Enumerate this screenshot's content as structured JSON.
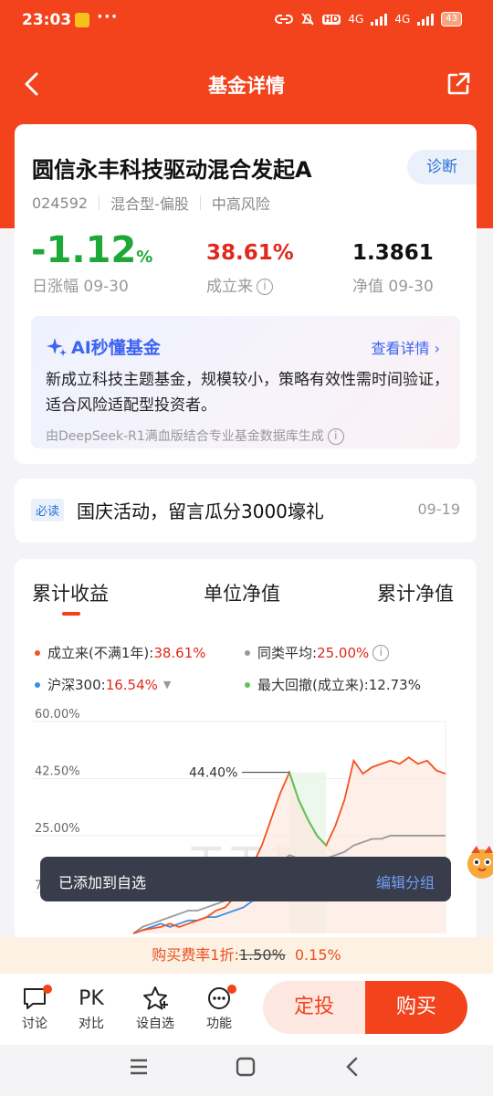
{
  "status_bar": {
    "time": "23:03",
    "more": "···",
    "hd": "HD",
    "net1": "4G",
    "net2": "4G",
    "battery": "43"
  },
  "nav": {
    "title": "基金详情"
  },
  "fund": {
    "name": "圆信永丰科技驱动混合发起A",
    "diagnose_label": "诊断",
    "code": "024592",
    "type": "混合型-偏股",
    "risk": "中高风险",
    "daily_change": "-1.12",
    "daily_change_unit": "%",
    "daily_change_label": "日涨幅 09-30",
    "since_inception": "38.61%",
    "since_inception_label": "成立来",
    "nav_value": "1.3861",
    "nav_label": "净值 09-30"
  },
  "ai": {
    "title": "AI秒懂基金",
    "link": "查看详情",
    "text": "新成立科技主题基金，规模较小，策略有效性需时间验证，适合风险适配型投资者。",
    "footer": "由DeepSeek-R1满血版结合专业基金数据库生成"
  },
  "notice": {
    "tag": "必读",
    "text": "国庆活动，留言瓜分3000壕礼",
    "date": "09-19"
  },
  "chart_tabs": [
    "累计收益",
    "单位净值",
    "累计净值"
  ],
  "legend": {
    "fund_label": "成立来(不满1年):",
    "fund_value": "38.61%",
    "peer_label": "同类平均:",
    "peer_value": "25.00%",
    "index_label": "沪深300:",
    "index_value": "16.54%",
    "drawdown_label": "最大回撤(成立来):",
    "drawdown_value": "12.73%",
    "colors": {
      "fund": "#f4521f",
      "peer": "#999999",
      "index": "#3a8ee6",
      "drawdown": "#5cc25c"
    }
  },
  "chart_data": {
    "type": "line",
    "y_ticks": [
      "60.00%",
      "42.50%",
      "25.00%",
      "7.50%"
    ],
    "ylim": [
      -5,
      60
    ],
    "annotation": "44.40%",
    "watermark": "天天基金",
    "series": [
      {
        "name": "成立来",
        "values": [
          -5,
          -4,
          -3.5,
          -3,
          -2,
          -3,
          -2,
          -1,
          0,
          2,
          3,
          6,
          10,
          16,
          22,
          30,
          38,
          44.4,
          36,
          30,
          25,
          22,
          28,
          36,
          48,
          44,
          46,
          47,
          48,
          47,
          49,
          47,
          48,
          45,
          44
        ]
      },
      {
        "name": "同类平均",
        "values": [
          -5,
          -3,
          -2,
          -1,
          0,
          1,
          2,
          2,
          3,
          4,
          5,
          7,
          9,
          11,
          13,
          15,
          17,
          19,
          18,
          17,
          17,
          18,
          19,
          20,
          22,
          23,
          24,
          24,
          25,
          25,
          25,
          25,
          25,
          25,
          25
        ]
      },
      {
        "name": "沪深300",
        "values": [
          -5,
          -4,
          -3,
          -2,
          -3,
          -2,
          -1,
          -1,
          0,
          0,
          1,
          2,
          3,
          5,
          7,
          8,
          10,
          12,
          11,
          10,
          11,
          12,
          13,
          13,
          14,
          14,
          15,
          15,
          16,
          16,
          16,
          16,
          16,
          16.5,
          16.5
        ]
      }
    ]
  },
  "toast": {
    "message": "已添加到自选",
    "action": "编辑分组"
  },
  "fee": {
    "label": "购买费率1折:",
    "original": "1.50%",
    "current": "0.15%"
  },
  "bottom": {
    "items": [
      {
        "label": "讨论",
        "icon": "chat-icon"
      },
      {
        "label": "对比",
        "icon": "pk-icon"
      },
      {
        "label": "设自选",
        "icon": "star-icon"
      },
      {
        "label": "功能",
        "icon": "more-icon"
      }
    ],
    "pk_text": "PK",
    "fixed_invest": "定投",
    "buy": "购买"
  }
}
